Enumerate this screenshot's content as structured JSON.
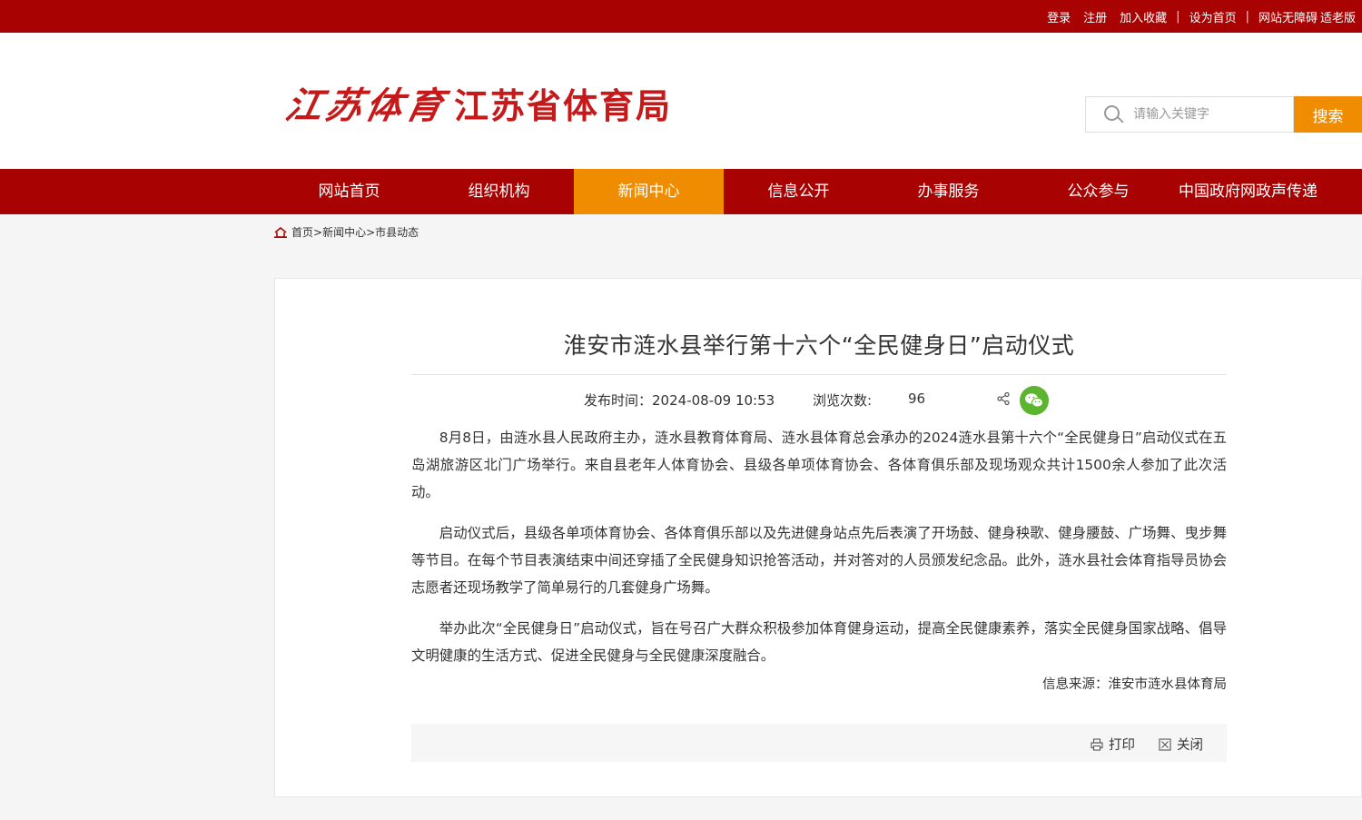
{
  "top_links": {
    "login": "登录",
    "register": "注册",
    "bookmark": "加入收藏",
    "set_home": "设为首页",
    "accessibility": "网站无障碍",
    "elder": "适老版",
    "separator": "|"
  },
  "header": {
    "logo_calligraphy": "江苏体育",
    "logo_name": "江苏省体育局",
    "search_placeholder": "请输入关键字",
    "search_button": "搜索"
  },
  "nav": {
    "items": [
      {
        "label": "网站首页"
      },
      {
        "label": "组织机构"
      },
      {
        "label": "新闻中心",
        "active": true
      },
      {
        "label": "信息公开"
      },
      {
        "label": "办事服务"
      },
      {
        "label": "公众参与"
      },
      {
        "label": "中国政府网政声传递"
      }
    ]
  },
  "breadcrumb": {
    "home": "首页",
    "sep": ">",
    "level1": "新闻中心",
    "level2": "市县动态"
  },
  "article": {
    "title": "淮安市涟水县举行第十六个“全民健身日”启动仪式",
    "publish_label": "发布时间：",
    "publish_time": "2024-08-09 10:53",
    "views_label": "浏览次数:",
    "views": "96",
    "paragraphs": [
      "8月8日，由涟水县人民政府主办，涟水县教育体育局、涟水县体育总会承办的2024涟水县第十六个“全民健身日”启动仪式在五岛湖旅游区北门广场举行。来自县老年人体育协会、县级各单项体育协会、各体育俱乐部及现场观众共计1500余人参加了此次活动。",
      "启动仪式后，县级各单项体育协会、各体育俱乐部以及先进健身站点先后表演了开场鼓、健身秧歌、健身腰鼓、广场舞、曳步舞等节目。在每个节目表演结束中间还穿插了全民健身知识抢答活动，并对答对的人员颁发纪念品。此外，涟水县社会体育指导员协会志愿者还现场教学了简单易行的几套健身广场舞。",
      "举办此次“全民健身日”启动仪式，旨在号召广大群众积极参加体育健身运动，提高全民健康素养，落实全民健身国家战略、倡导文明健康的生活方式、促进全民健身与全民健康深度融合。"
    ],
    "source": "信息来源：淮安市涟水县体育局",
    "print_label": "打印",
    "close_label": "关闭"
  },
  "colors": {
    "brand_red": "#a80202",
    "accent_orange": "#f08c00",
    "wechat_green": "#5cb531"
  }
}
